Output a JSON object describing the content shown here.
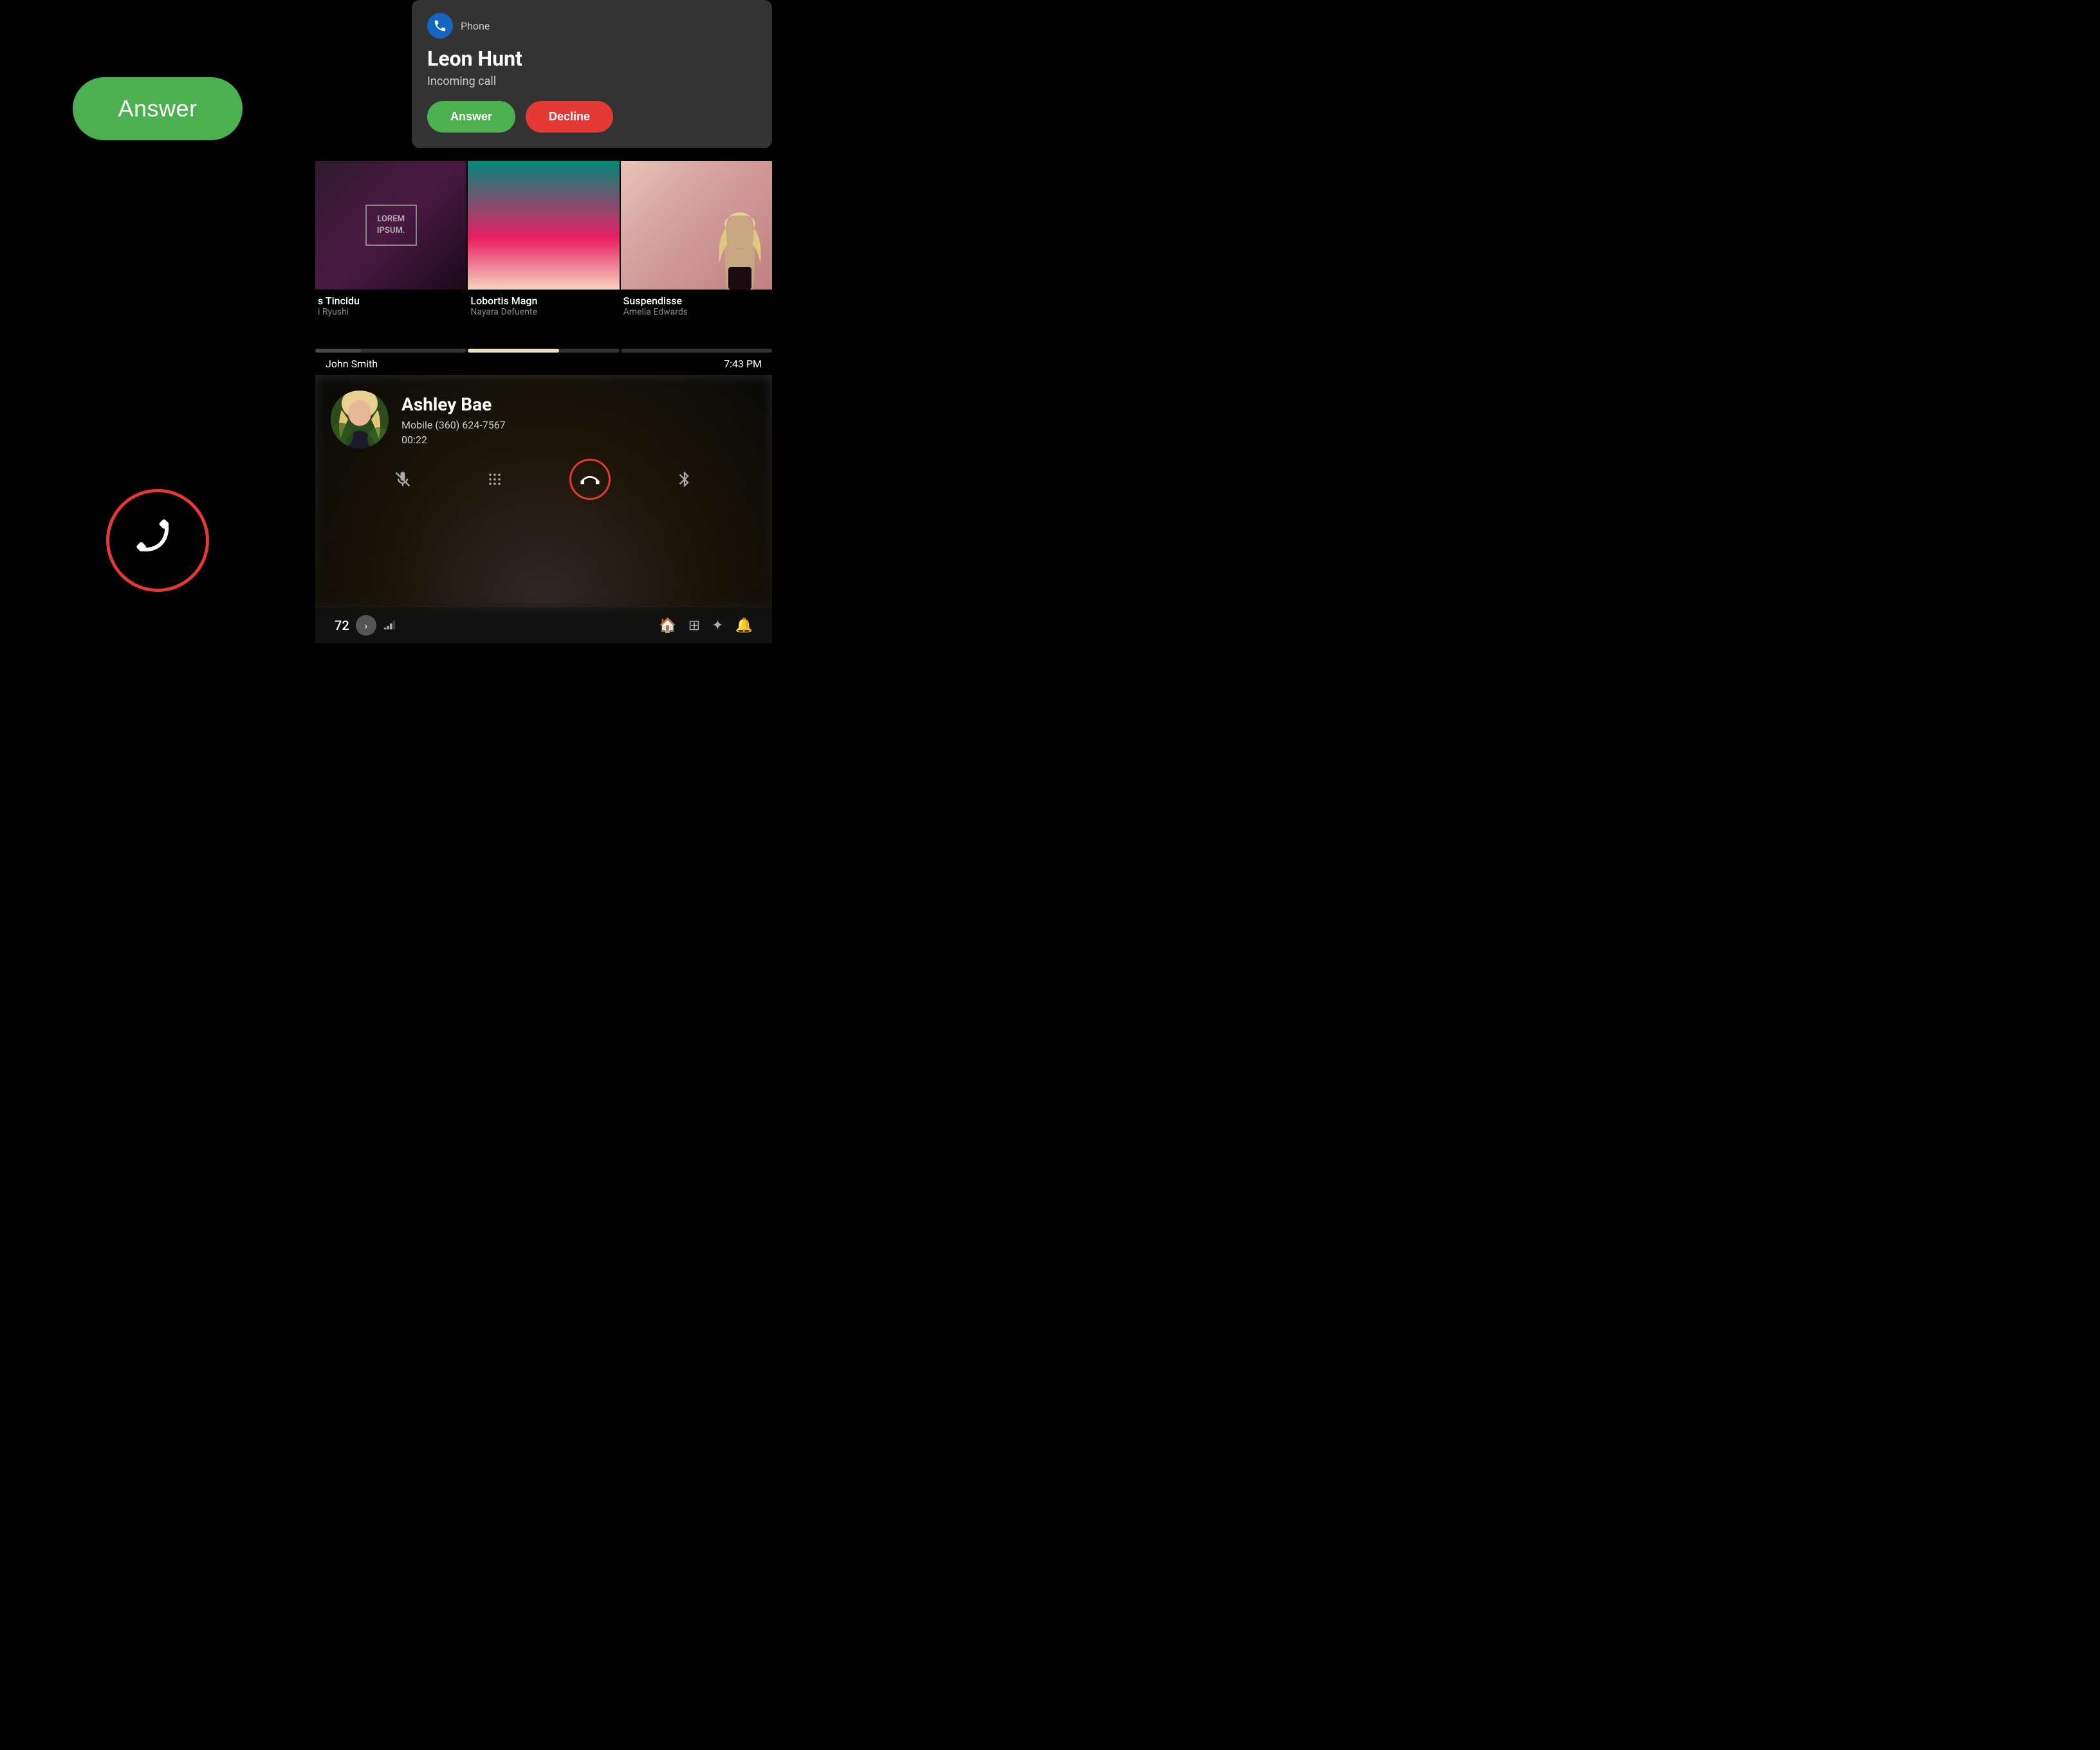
{
  "left": {
    "answer_label": "Answer",
    "end_icon": "📞"
  },
  "notification": {
    "app_name": "Phone",
    "caller_name": "Leon Hunt",
    "subtitle": "Incoming call",
    "answer_label": "Answer",
    "decline_label": "Decline"
  },
  "media_cards": [
    {
      "title": "s Tincidu",
      "author": "i Ryushi",
      "lorem": "LOREM\nIPSUM.",
      "progress": 30
    },
    {
      "title": "Lobortis Magn",
      "author": "Nayara Defuente",
      "progress": 60
    },
    {
      "title": "Suspendisse",
      "author": "Amelia Edwards",
      "progress": 10
    }
  ],
  "status_bar": {
    "name": "John Smith",
    "time": "7:43 PM"
  },
  "active_call": {
    "contact_name": "Ashley Bae",
    "phone_label": "Mobile (360) 624-7567",
    "duration": "00:22"
  },
  "call_controls": {
    "mute_icon": "🎤",
    "keypad_icon": "⌨",
    "end_icon": "📞",
    "bluetooth_icon": "⚡"
  },
  "system_bar": {
    "temperature": "72",
    "icons": [
      "🔔",
      "⚡",
      "⊞",
      "🏠",
      "🎛"
    ]
  },
  "colors": {
    "green": "#4CAF50",
    "red": "#E53935",
    "dark_bg": "#1a1a1a",
    "notification_bg": "#333333"
  }
}
